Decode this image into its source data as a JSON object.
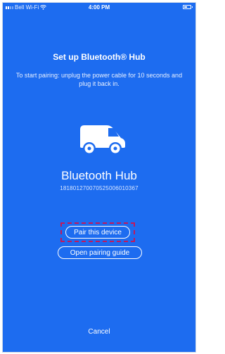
{
  "status_bar": {
    "carrier": "Bell Wi-Fi",
    "time": "4:00 PM"
  },
  "setup": {
    "title": "Set up Bluetooth® Hub",
    "instructions": "To start pairing: unplug the power cable for 10 seconds and plug it back in."
  },
  "device": {
    "icon": "car-icon",
    "name": "Bluetooth Hub",
    "id": "181801270070525006010367"
  },
  "actions": {
    "pair_label": "Pair this device",
    "guide_label": "Open pairing guide",
    "cancel_label": "Cancel"
  },
  "colors": {
    "background": "#1d6cf0",
    "highlight_border": "#c2185b"
  }
}
